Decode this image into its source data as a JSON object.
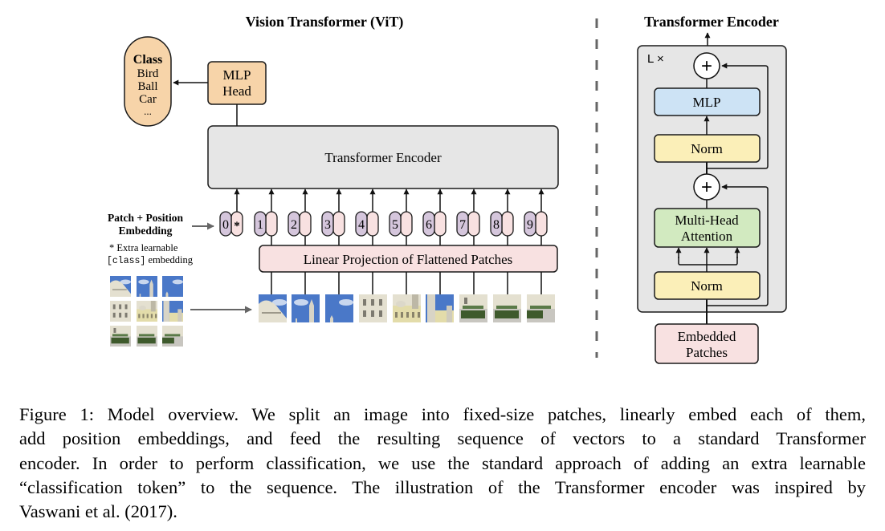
{
  "vit": {
    "title": "Vision Transformer (ViT)",
    "class_box": {
      "heading": "Class",
      "items": [
        "Bird",
        "Ball",
        "Car",
        "..."
      ]
    },
    "mlp_head": {
      "line1": "MLP",
      "line2": "Head"
    },
    "encoder_label": "Transformer Encoder",
    "embedding_label": {
      "line1": "Patch + Position",
      "line2": "Embedding"
    },
    "footnote": {
      "line1": "* Extra learnable",
      "code": "[class]",
      "line2_rest": " embedding"
    },
    "tokens": [
      {
        "position": "0",
        "content": "*"
      },
      {
        "position": "1",
        "content": ""
      },
      {
        "position": "2",
        "content": ""
      },
      {
        "position": "3",
        "content": ""
      },
      {
        "position": "4",
        "content": ""
      },
      {
        "position": "5",
        "content": ""
      },
      {
        "position": "6",
        "content": ""
      },
      {
        "position": "7",
        "content": ""
      },
      {
        "position": "8",
        "content": ""
      },
      {
        "position": "9",
        "content": ""
      }
    ],
    "projection_label": "Linear Projection of Flattened Patches",
    "patch_count": 9,
    "grid_rows": 3,
    "grid_cols": 3
  },
  "encoder_detail": {
    "title": "Transformer Encoder",
    "repeat_label": "L ×",
    "plus_symbol": "+",
    "mlp_label": "MLP",
    "norm_label": "Norm",
    "attention": {
      "line1": "Multi-Head",
      "line2": "Attention"
    },
    "input": {
      "line1": "Embedded",
      "line2": "Patches"
    }
  },
  "colors": {
    "class_fill": "#f7d4a9",
    "mlp_head_fill": "#f7d4a9",
    "encoder_fill": "#e6e6e6",
    "position_fill": "#d5c6dc",
    "content_fill": "#f8e1e1",
    "projection_fill": "#f8e1e1",
    "mlp_fill": "#cde3f5",
    "norm_fill": "#fbefb8",
    "attention_fill": "#d2eac0",
    "embedded_fill": "#f8e1e1",
    "outer_fill": "#e6e6e6",
    "stroke": "#1a1a1a",
    "divider": "#666666",
    "sky": "#4a78c8",
    "building": "#e4e0d0",
    "building_yellow": "#e3dcaa",
    "garden": "#3e5a2c",
    "path": "#c8c6c0"
  },
  "caption": {
    "lines": [
      "Figure 1: Model overview. We split an image into fixed-size patches, linearly embed each of them,",
      "add position embeddings, and feed the resulting sequence of vectors to a standard Transformer",
      "encoder. In order to perform classification, we use the standard approach of adding an extra learnable",
      "“classification token” to the sequence. The illustration of the Transformer encoder was inspired by",
      "Vaswani et al. (2017)."
    ]
  }
}
